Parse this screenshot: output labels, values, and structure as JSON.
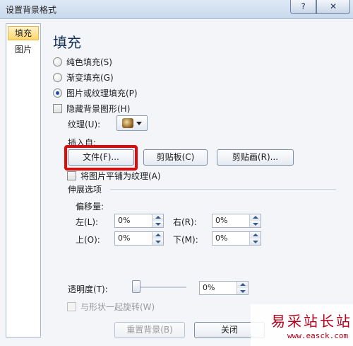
{
  "window": {
    "title": "设置背景格式",
    "help_label": "?",
    "close_label": "✕"
  },
  "sidebar": {
    "items": [
      {
        "label": "填充",
        "selected": true
      },
      {
        "label": "图片",
        "selected": false
      }
    ]
  },
  "fill": {
    "heading": "填充",
    "options": [
      {
        "label": "纯色填充(S)",
        "checked": false
      },
      {
        "label": "渐变填充(G)",
        "checked": false
      },
      {
        "label": "图片或纹理填充(P)",
        "checked": true
      }
    ],
    "hide_bg_label": "隐藏背景图形(H)",
    "texture_label": "纹理(U):",
    "insert_from_label": "插入自:",
    "buttons": {
      "file": "文件(F)...",
      "clipboard": "剪贴板(C)",
      "clipart": "剪贴画(R)..."
    },
    "tile_label": "将图片平铺为纹理(A)",
    "stretch_title": "伸展选项",
    "offset_label": "偏移量:",
    "offsets": {
      "left": {
        "label": "左(L):",
        "value": "0%"
      },
      "right": {
        "label": "右(R):",
        "value": "0%"
      },
      "top": {
        "label": "上(O):",
        "value": "0%"
      },
      "bottom": {
        "label": "下(M):",
        "value": "0%"
      }
    },
    "transparency": {
      "label": "透明度(T):",
      "value": "0%",
      "level": 0
    },
    "rotate_label": "与形状一起旋转(W)"
  },
  "footer": {
    "reset_label": "重置背景(B)",
    "close_label": "关闭"
  },
  "watermark": {
    "site_cn": "易采站长站",
    "site_url": "www.easck.com"
  }
}
